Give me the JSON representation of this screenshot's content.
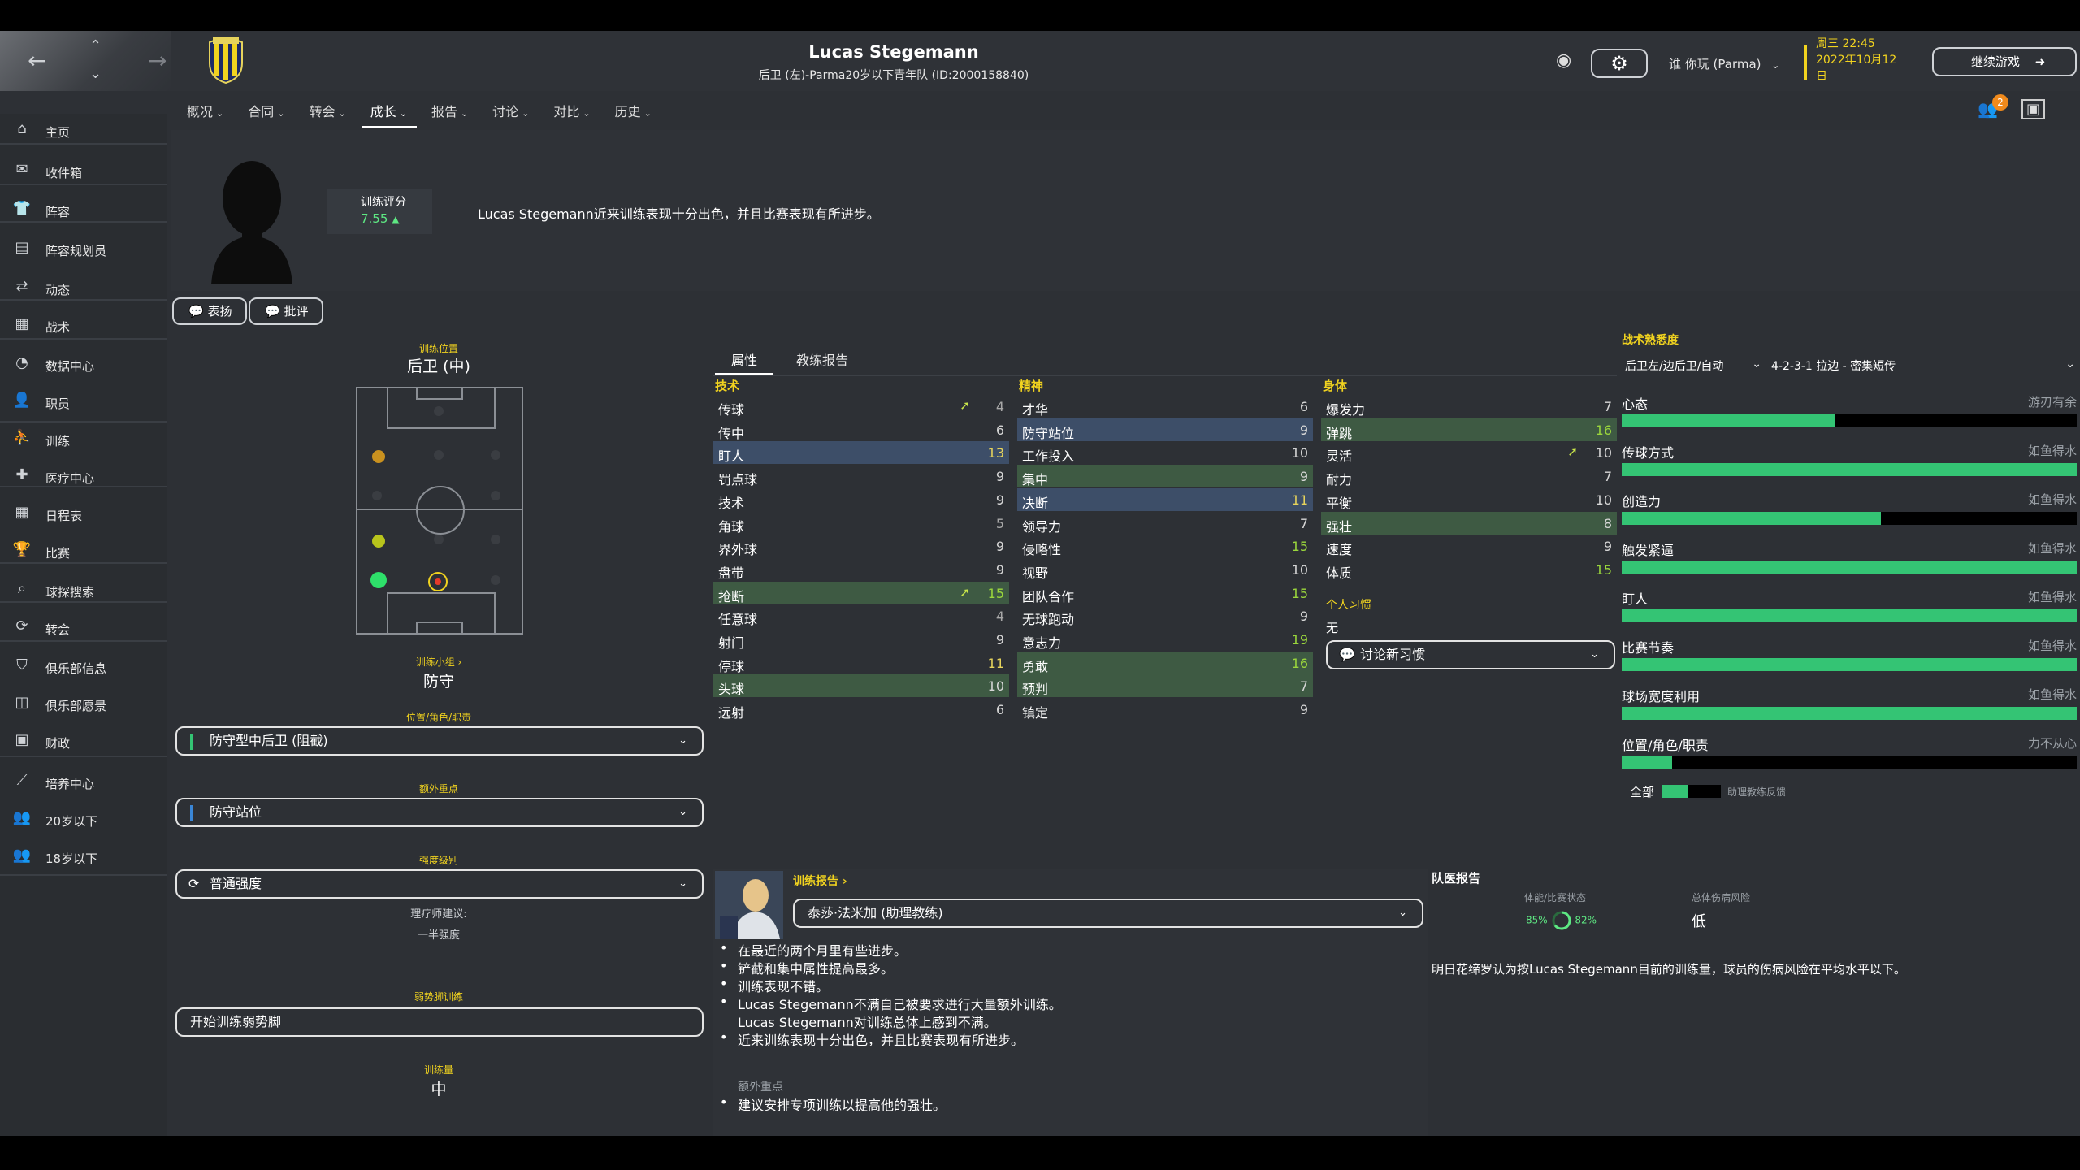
{
  "window": {
    "player_name": "Lucas Stegemann",
    "subtitle": "后卫 (左)-Parma20岁以下青年队 (ID:2000158840)"
  },
  "topbar": {
    "game_label": "谁 你玩 (Parma)",
    "date_line1": "周三 22:45",
    "date_line2": "2022年10月12",
    "date_line3": "日",
    "continue_label": "继续游戏",
    "notif_count": "2"
  },
  "tabs": [
    {
      "label": "概况"
    },
    {
      "label": "合同"
    },
    {
      "label": "转会"
    },
    {
      "label": "成长"
    },
    {
      "label": "报告"
    },
    {
      "label": "讨论"
    },
    {
      "label": "对比"
    },
    {
      "label": "历史"
    }
  ],
  "sidebar": {
    "items": [
      {
        "label": "主页",
        "icon": "home-icon"
      },
      {
        "label": "收件箱",
        "icon": "inbox-icon"
      },
      {
        "label": "阵容",
        "icon": "shirt-icon"
      },
      {
        "label": "阵容规划员",
        "icon": "clipboard-icon"
      },
      {
        "label": "动态",
        "icon": "dynamics-icon"
      },
      {
        "label": "战术",
        "icon": "tactics-icon"
      },
      {
        "label": "数据中心",
        "icon": "data-icon"
      },
      {
        "label": "职员",
        "icon": "staff-icon"
      },
      {
        "label": "训练",
        "icon": "training-icon"
      },
      {
        "label": "医疗中心",
        "icon": "medical-icon"
      },
      {
        "label": "日程表",
        "icon": "calendar-icon"
      },
      {
        "label": "比赛",
        "icon": "trophy-icon"
      },
      {
        "label": "球探搜索",
        "icon": "search-icon"
      },
      {
        "label": "转会",
        "icon": "transfer-icon"
      },
      {
        "label": "俱乐部信息",
        "icon": "shield-icon"
      },
      {
        "label": "俱乐部愿景",
        "icon": "vision-icon"
      },
      {
        "label": "财政",
        "icon": "finance-icon"
      },
      {
        "label": "培养中心",
        "icon": "development-icon"
      },
      {
        "label": "20岁以下",
        "icon": "u20-icon"
      },
      {
        "label": "18岁以下",
        "icon": "u18-icon"
      }
    ]
  },
  "header": {
    "rating_label": "训练评分",
    "rating_value": "7.55",
    "summary": "Lucas Stegemann近来训练表现十分出色，并且比赛表现有所进步。",
    "praise_label": "表扬",
    "criticize_label": "批评"
  },
  "left": {
    "position_label": "训练位置",
    "position_value": "后卫 (中)",
    "group_label": "训练小组 ›",
    "group_value": "防守",
    "role_label": "位置/角色/职责",
    "role_value": "防守型中后卫 (阻截)",
    "extra_label": "额外重点",
    "extra_value": "防守站位",
    "intensity_label": "强度级别",
    "intensity_value": "普通强度",
    "physio_label": "理疗师建议:",
    "physio_value": "一半强度",
    "weakfoot_label": "弱势脚训练",
    "weakfoot_value": "开始训练弱势脚",
    "load_label": "训练量",
    "load_value": "中"
  },
  "middle": {
    "tab_attributes": "属性",
    "tab_coach_report": "教练报告",
    "technical_header": "技术",
    "mental_header": "精神",
    "physical_header": "身体",
    "technical": [
      {
        "name": "传球",
        "value": "4"
      },
      {
        "name": "传中",
        "value": "6"
      },
      {
        "name": "盯人",
        "value": "13"
      },
      {
        "name": "罚点球",
        "value": "9"
      },
      {
        "name": "技术",
        "value": "9"
      },
      {
        "name": "角球",
        "value": "5"
      },
      {
        "name": "界外球",
        "value": "9"
      },
      {
        "name": "盘带",
        "value": "9"
      },
      {
        "name": "抢断",
        "value": "15"
      },
      {
        "name": "任意球",
        "value": "4"
      },
      {
        "name": "射门",
        "value": "9"
      },
      {
        "name": "停球",
        "value": "11"
      },
      {
        "name": "头球",
        "value": "10"
      },
      {
        "name": "远射",
        "value": "6"
      }
    ],
    "mental": [
      {
        "name": "才华",
        "value": "6"
      },
      {
        "name": "防守站位",
        "value": "9"
      },
      {
        "name": "工作投入",
        "value": "10"
      },
      {
        "name": "集中",
        "value": "9"
      },
      {
        "name": "决断",
        "value": "11"
      },
      {
        "name": "领导力",
        "value": "7"
      },
      {
        "name": "侵略性",
        "value": "15"
      },
      {
        "name": "视野",
        "value": "10"
      },
      {
        "name": "团队合作",
        "value": "15"
      },
      {
        "name": "无球跑动",
        "value": "9"
      },
      {
        "name": "意志力",
        "value": "19"
      },
      {
        "name": "勇敢",
        "value": "16"
      },
      {
        "name": "预判",
        "value": "7"
      },
      {
        "name": "镇定",
        "value": "9"
      }
    ],
    "physical": [
      {
        "name": "爆发力",
        "value": "7"
      },
      {
        "name": "弹跳",
        "value": "16"
      },
      {
        "name": "灵活",
        "value": "10"
      },
      {
        "name": "耐力",
        "value": "7"
      },
      {
        "name": "平衡",
        "value": "10"
      },
      {
        "name": "强壮",
        "value": "8"
      },
      {
        "name": "速度",
        "value": "9"
      },
      {
        "name": "体质",
        "value": "15"
      }
    ],
    "traits_header": "个人习惯",
    "traits_value": "无",
    "traits_dropdown": "讨论新习惯"
  },
  "tactics": {
    "header": "战术熟悉度",
    "position_select": "后卫左/边后卫/自动",
    "formation_select": "4-2-3-1 拉边 - 密集短传",
    "rows": [
      {
        "name": "心态",
        "status": "游刃有余",
        "fill": 0.47
      },
      {
        "name": "传球方式",
        "status": "如鱼得水",
        "fill": 1.0
      },
      {
        "name": "创造力",
        "status": "如鱼得水",
        "fill": 0.57
      },
      {
        "name": "触发紧逼",
        "status": "如鱼得水",
        "fill": 1.0
      },
      {
        "name": "盯人",
        "status": "如鱼得水",
        "fill": 1.0
      },
      {
        "name": "比赛节奏",
        "status": "如鱼得水",
        "fill": 1.0
      },
      {
        "name": "球场宽度利用",
        "status": "如鱼得水",
        "fill": 1.0
      },
      {
        "name": "位置/角色/职责",
        "status": "力不从心",
        "fill": 0.11
      }
    ],
    "all_label": "全部",
    "assist_label": "助理教练反馈"
  },
  "report": {
    "title": "训练报告 ›",
    "coach": "泰莎·法米加 (助理教练)",
    "bullets": [
      "在最近的两个月里有些进步。",
      "铲截和集中属性提高最多。",
      "训练表现不错。",
      "Lucas Stegemann不满自己被要求进行大量额外训练。",
      "近来训练表现十分出色，并且比赛表现有所进步。"
    ],
    "sub_line": "Lucas Stegemann对训练总体上感到不满。",
    "extra_header": "额外重点",
    "extra_bullet": "建议安排专项训练以提高他的强壮。"
  },
  "medical": {
    "title": "队医报告",
    "fitness_label": "体能/比赛状态",
    "fitness_value_1": "85%",
    "fitness_value_2": "82%",
    "injury_label": "总体伤病风险",
    "injury_value": "低",
    "note": "明日花缔罗认为按Lucas Stegemann目前的训练量，球员的伤病风险在平均水平以下。"
  }
}
